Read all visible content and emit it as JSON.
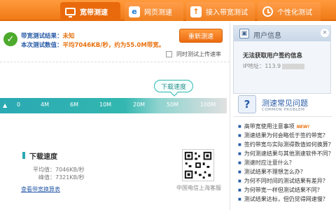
{
  "tabs": [
    {
      "label": "宽带测速",
      "icon": "monitor-icon",
      "active": true
    },
    {
      "label": "网页测速",
      "icon": "ie-browser-icon",
      "active": false
    },
    {
      "label": "接入带宽测试",
      "icon": "upload-arrow-icon",
      "active": false
    },
    {
      "label": "个性化测试",
      "icon": "clock-icon",
      "active": false
    }
  ],
  "result": {
    "status_label": "带宽测试结果：",
    "status_value": "未知",
    "speed_label": "本次测试数值：",
    "speed_value": "平均7046KB/秒，约为55.0M带宽。"
  },
  "retest_button": "重新测速",
  "upload_option": "同时测试上传速率",
  "scale": {
    "bubble": "下载速度",
    "ticks": [
      "0",
      "4M",
      "6M",
      "10M",
      "20M",
      "50M",
      "100M"
    ]
  },
  "download": {
    "title": "下载速度",
    "avg_label": "平均值：",
    "avg_value": "7046KB/秒",
    "peak_label": "峰值：",
    "peak_value": "7321KB/秒",
    "link": "查看带宽换算表"
  },
  "qr_caption": "中国电信上海客服",
  "user_panel": {
    "title": "用户信息",
    "info": "无法获取用户签约信息",
    "ip_label": "IP地址：",
    "ip_value": "113.9"
  },
  "faq": {
    "title": "测速常见问题",
    "subtitle": "COMMON PROBLEM",
    "new_badge": "NEW!",
    "items": [
      "高带宽使用注意事项",
      "测速结果为何会略低于签约带宽？",
      "签约带宽与实际测得数值如何换算？",
      "为何测速结果与其他测速软件不同？",
      "测速时应注意什么？",
      "测试结果不理想怎么办？",
      "为何不同时间的测试结果有差异？",
      "为何带宽一样但测试结果不同？",
      "测试结果达标，但仍觉得网速慢？"
    ]
  },
  "colors": {
    "accent": "#f07a16",
    "link": "#2a5da8",
    "teal": "#2aa9b3",
    "success": "#4caa2c"
  }
}
